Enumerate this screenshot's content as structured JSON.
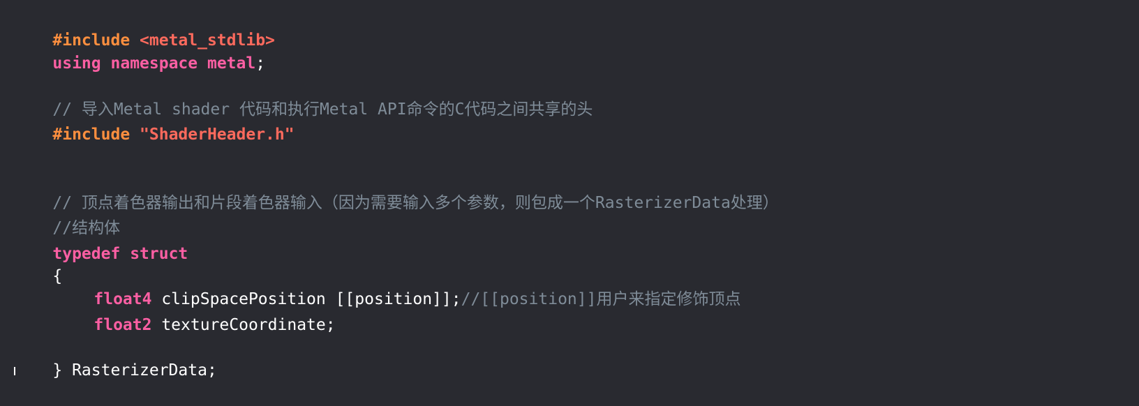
{
  "editor": {
    "lines": [
      {
        "parts": [
          "#include",
          " ",
          "<metal_stdlib>"
        ]
      },
      {
        "parts": [
          "using",
          " ",
          "namespace",
          " ",
          "metal",
          ";"
        ]
      },
      {
        "parts": [
          "// 导入Metal shader 代码和执行Metal API命令的C代码之间共享的头"
        ]
      },
      {
        "parts": [
          "#include",
          " ",
          "\"ShaderHeader.h\""
        ]
      },
      {
        "parts": [
          "// 顶点着色器输出和片段着色器输入（因为需要输入多个参数，则包成一个RasterizerData处理）"
        ]
      },
      {
        "parts": [
          "//结构体"
        ]
      },
      {
        "parts": [
          "typedef",
          " ",
          "struct"
        ]
      },
      {
        "parts": [
          "{"
        ]
      },
      {
        "parts": [
          "float4",
          " clipSpacePosition [[position]];",
          "//[[position]]用户来指定修饰顶点"
        ]
      },
      {
        "parts": [
          "float2",
          " textureCoordinate;"
        ]
      },
      {
        "parts": [
          "} RasterizerData;"
        ]
      }
    ]
  }
}
